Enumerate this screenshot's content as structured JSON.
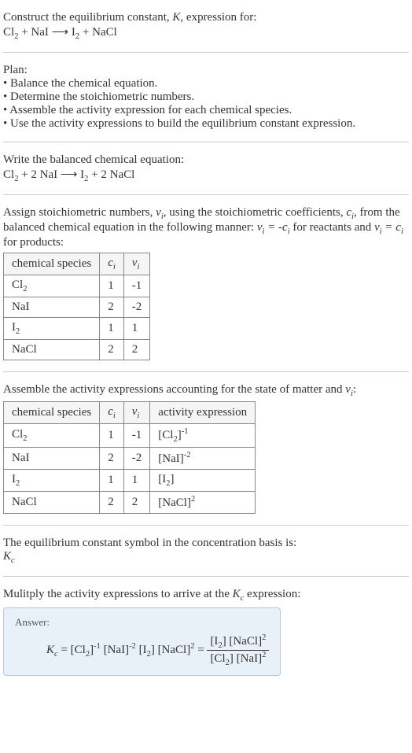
{
  "intro": {
    "line1_prefix": "Construct the equilibrium constant, ",
    "line1_k": "K",
    "line1_suffix": ", expression for:",
    "equation_unbalanced": "Cl₂ + NaI ⟶ I₂ + NaCl"
  },
  "plan": {
    "heading": "Plan:",
    "bullet1": "• Balance the chemical equation.",
    "bullet2": "• Determine the stoichiometric numbers.",
    "bullet3": "• Assemble the activity expression for each chemical species.",
    "bullet4": "• Use the activity expressions to build the equilibrium constant expression."
  },
  "balanced": {
    "heading": "Write the balanced chemical equation:",
    "equation": "Cl₂ + 2 NaI ⟶ I₂ + 2 NaCl"
  },
  "assign": {
    "text_prefix": "Assign stoichiometric numbers, ",
    "nu_i": "νᵢ",
    "text_mid1": ", using the stoichiometric coefficients, ",
    "c_i": "cᵢ",
    "text_mid2": ", from the balanced chemical equation in the following manner: ",
    "rel1": "νᵢ = -cᵢ",
    "text_mid3": " for reactants and ",
    "rel2": "νᵢ = cᵢ",
    "text_suffix": " for products:"
  },
  "table1": {
    "h1": "chemical species",
    "h2": "cᵢ",
    "h3": "νᵢ",
    "rows": [
      {
        "species": "Cl₂",
        "c": "1",
        "nu": "-1"
      },
      {
        "species": "NaI",
        "c": "2",
        "nu": "-2"
      },
      {
        "species": "I₂",
        "c": "1",
        "nu": "1"
      },
      {
        "species": "NaCl",
        "c": "2",
        "nu": "2"
      }
    ]
  },
  "assemble": {
    "text_prefix": "Assemble the activity expressions accounting for the state of matter and ",
    "nu_i": "νᵢ",
    "text_suffix": ":"
  },
  "table2": {
    "h1": "chemical species",
    "h2": "cᵢ",
    "h3": "νᵢ",
    "h4": "activity expression",
    "rows": [
      {
        "species": "Cl₂",
        "c": "1",
        "nu": "-1",
        "act_base": "[Cl₂]",
        "act_exp": "-1"
      },
      {
        "species": "NaI",
        "c": "2",
        "nu": "-2",
        "act_base": "[NaI]",
        "act_exp": "-2"
      },
      {
        "species": "I₂",
        "c": "1",
        "nu": "1",
        "act_base": "[I₂]",
        "act_exp": ""
      },
      {
        "species": "NaCl",
        "c": "2",
        "nu": "2",
        "act_base": "[NaCl]",
        "act_exp": "2"
      }
    ]
  },
  "symbol": {
    "text": "The equilibrium constant symbol in the concentration basis is:",
    "kc": "K꜀"
  },
  "multiply": {
    "text_prefix": "Mulitply the activity expressions to arrive at the ",
    "kc": "K꜀",
    "text_suffix": " expression:"
  },
  "answer": {
    "label": "Answer:",
    "kc": "K꜀",
    "eq": " = ",
    "lhs_part1_base": "[Cl₂]",
    "lhs_part1_exp": "-1",
    "lhs_part2_base": "[NaI]",
    "lhs_part2_exp": "-2",
    "lhs_part3_base": "[I₂]",
    "lhs_part4_base": "[NaCl]",
    "lhs_part4_exp": "2",
    "frac_num_1_base": "[I₂]",
    "frac_num_2_base": "[NaCl]",
    "frac_num_2_exp": "2",
    "frac_den_1_base": "[Cl₂]",
    "frac_den_2_base": "[NaI]",
    "frac_den_2_exp": "2"
  },
  "chart_data": null
}
